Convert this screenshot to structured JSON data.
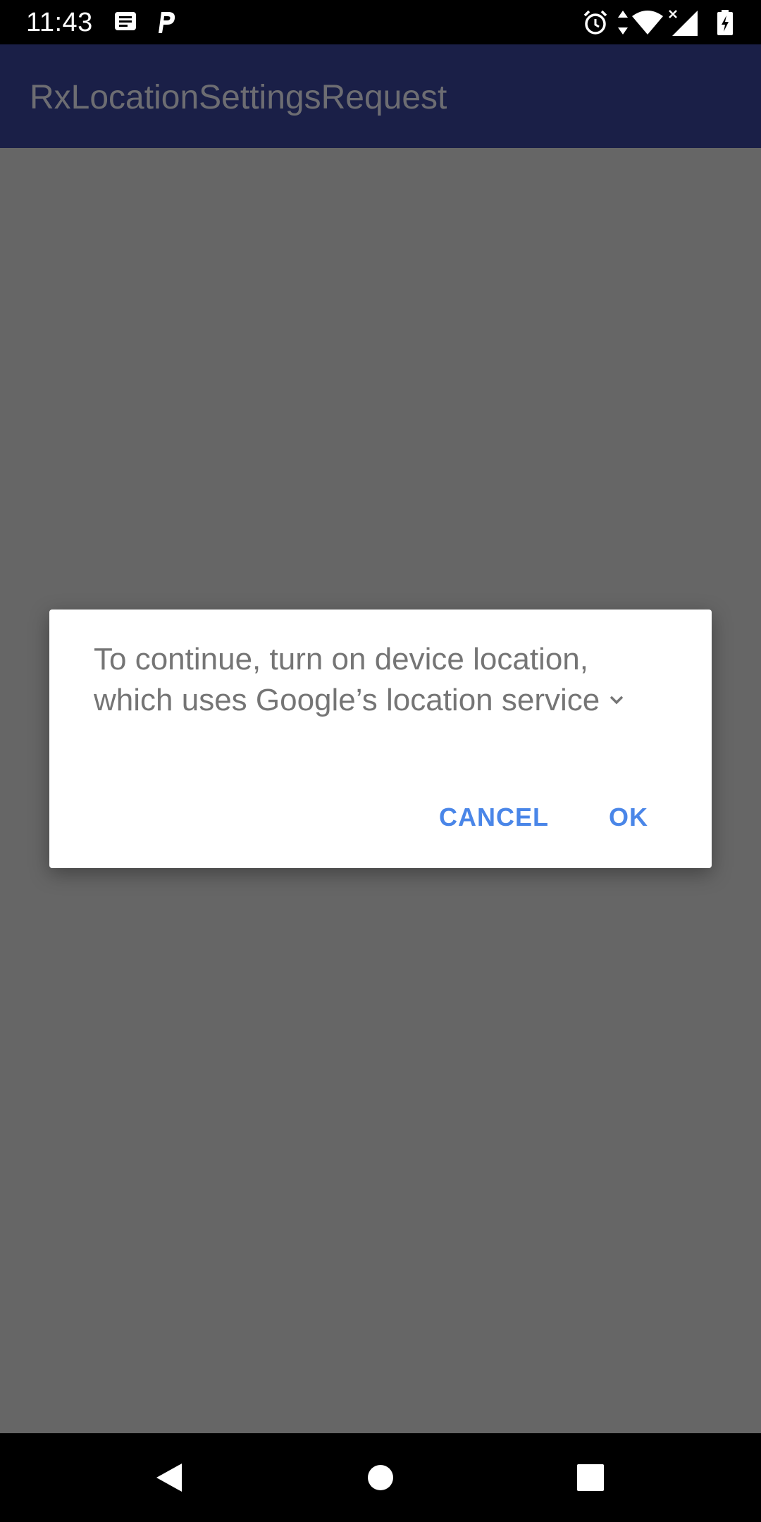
{
  "status_bar": {
    "time": "11:43",
    "icons_left": [
      "message-notification-icon",
      "parking-app-icon"
    ],
    "icons_right": [
      "alarm-icon",
      "data-arrows-icon",
      "wifi-icon",
      "signal-icon",
      "battery-charging-icon"
    ]
  },
  "app_bar": {
    "title": "RxLocationSettingsRequest"
  },
  "dialog": {
    "message_line_1": "To continue, turn on device location,",
    "message_line_2": "which uses Google’s location service",
    "cancel_label": "CANCEL",
    "ok_label": "OK"
  },
  "nav_bar": {
    "icons": [
      "back-icon",
      "home-icon",
      "recents-icon"
    ]
  },
  "colors": {
    "app_bar": "#1a1f47",
    "scrim": "#666666",
    "accent": "#4a86e8"
  }
}
